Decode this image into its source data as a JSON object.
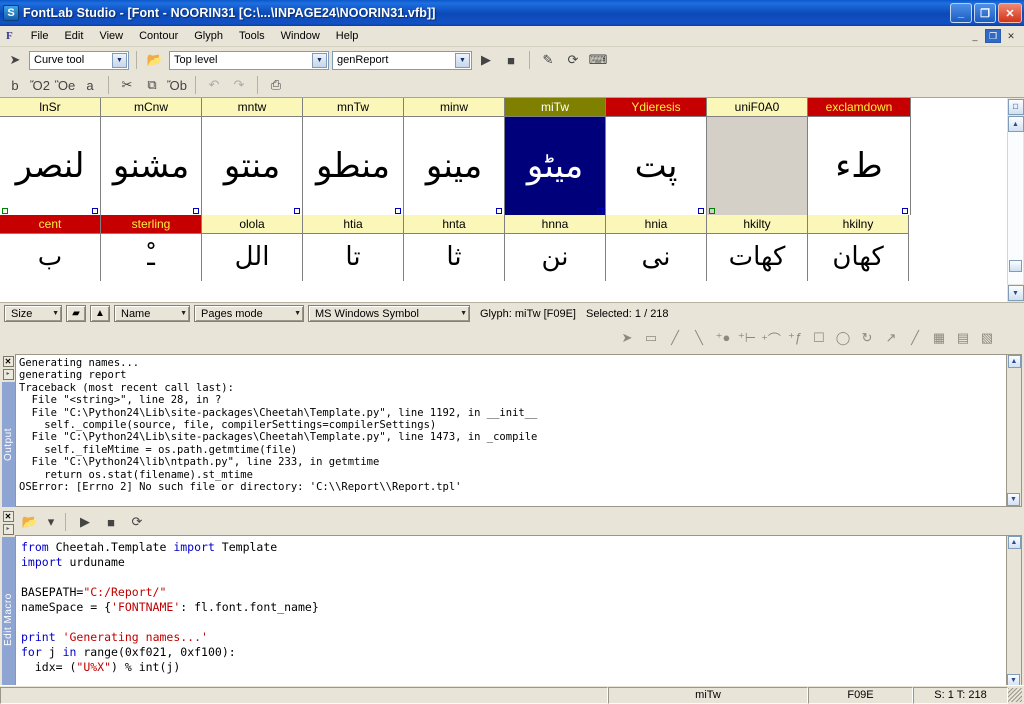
{
  "window": {
    "title": "FontLab Studio - [Font - NOORIN31 [C:\\...\\INPAGE24\\NOORIN31.vfb]]",
    "app_icon": "S",
    "buttons": {
      "minimize": "_",
      "restore": "❐",
      "close": "✕"
    }
  },
  "menu": {
    "logo": "F",
    "items": [
      "File",
      "Edit",
      "View",
      "Contour",
      "Glyph",
      "Tools",
      "Window",
      "Help"
    ],
    "mdi": {
      "minimize": "_",
      "restore": "❐",
      "close": "✕"
    }
  },
  "toolbar": {
    "pointer_icon": "➤",
    "tool_combo": "Curve tool",
    "open_macro_icon": "folder-macro-icon",
    "level_combo": "Top level",
    "macro_combo": "genReport",
    "run_icon": "▶",
    "stop_icon": "■",
    "edit_macro_icon": "✎",
    "reload_icon": "⟳",
    "console_icon": "⌨"
  },
  "filebar": {
    "new": "὜b",
    "open": "Ὄ2",
    "save": "Ὃe",
    "save_all": "὚a",
    "cut": "✂",
    "copy": "⧉",
    "paste": "Ὄb",
    "undo": "↶",
    "redo": "↷",
    "print": "⎙"
  },
  "glyph_grid": {
    "row1": [
      {
        "name": "lnSr",
        "style": "yellow",
        "glyph": "لنصر",
        "mark_left": "green",
        "mark_right": "blue"
      },
      {
        "name": "mCnw",
        "style": "yellow",
        "glyph": "مشنو",
        "mark_left": "",
        "mark_right": "blue"
      },
      {
        "name": "mntw",
        "style": "yellow",
        "glyph": "منتو",
        "mark_left": "",
        "mark_right": "blue"
      },
      {
        "name": "mnTw",
        "style": "yellow",
        "glyph": "منطو",
        "mark_left": "",
        "mark_right": "blue"
      },
      {
        "name": "minw",
        "style": "yellow",
        "glyph": "مینو",
        "mark_left": "",
        "mark_right": "blue"
      },
      {
        "name": "miTw",
        "style": "olive",
        "glyph": "میٹو",
        "mark_left": "",
        "mark_right": "blue",
        "selected": true
      },
      {
        "name": "Ydieresis",
        "style": "red",
        "glyph": "پت",
        "mark_left": "",
        "mark_right": "blue"
      },
      {
        "name": "uniF0A0",
        "style": "yellow",
        "glyph": "",
        "mark_left": "green",
        "mark_right": "",
        "grayed": true
      },
      {
        "name": "exclamdown",
        "style": "red",
        "glyph": "طء",
        "mark_left": "",
        "mark_right": "blue"
      }
    ],
    "row2": [
      {
        "name": "cent",
        "style": "red",
        "glyph": "ب"
      },
      {
        "name": "sterling",
        "style": "red",
        "glyph": "ـْ"
      },
      {
        "name": "olola",
        "style": "yellow",
        "glyph": "الل"
      },
      {
        "name": "htia",
        "style": "yellow",
        "glyph": "تا"
      },
      {
        "name": "hnta",
        "style": "yellow",
        "glyph": "ثا"
      },
      {
        "name": "hnna",
        "style": "yellow",
        "glyph": "نن"
      },
      {
        "name": "hnia",
        "style": "yellow",
        "glyph": "نی"
      },
      {
        "name": "hkilty",
        "style": "yellow",
        "glyph": "کھات"
      },
      {
        "name": "hkilny",
        "style": "yellow",
        "glyph": "کھان"
      }
    ]
  },
  "glyph_status": {
    "size_combo": "Size",
    "zoom_out_icon": "▰",
    "zoom_in_icon": "▲",
    "name_combo": "Name",
    "mode_combo": "Pages mode",
    "encoding_combo": "MS Windows Symbol",
    "glyph_info": "Glyph: miTw [F09E]",
    "selected_info": "Selected: 1 / 218"
  },
  "draw_toolbar": {
    "icons": [
      "arrow-icon",
      "eraser-icon",
      "knife-icon",
      "ruler-icon",
      "add-node-icon",
      "add-tangent-icon",
      "add-curve-icon",
      "add-corner-icon",
      "rectangle-icon",
      "ellipse-icon",
      "rotate-icon",
      "scale-icon",
      "slant-icon",
      "transform-icon",
      "metrics-icon",
      "kerning-icon"
    ]
  },
  "output_panel": {
    "label": "Output",
    "close_icon": "✕",
    "expand_icon": "▸",
    "text": "Generating names...\ngenerating report\nTraceback (most recent call last):\n  File \"<string>\", line 28, in ?\n  File \"C:\\Python24\\Lib\\site-packages\\Cheetah\\Template.py\", line 1192, in __init__\n    self._compile(source, file, compilerSettings=compilerSettings)\n  File \"C:\\Python24\\Lib\\site-packages\\Cheetah\\Template.py\", line 1473, in _compile\n    self._fileMtime = os.path.getmtime(file)\n  File \"C:\\Python24\\lib\\ntpath.py\", line 233, in getmtime\n    return os.stat(filename).st_mtime\nOSError: [Errno 2] No such file or directory: 'C:\\\\Report\\\\Report.tpl'"
  },
  "macro_panel": {
    "label": "Edit Macro",
    "close_icon": "✕",
    "expand_icon": "▸",
    "toolbar": {
      "open_icon": "folder-save-icon",
      "dropdown_icon": "▾",
      "run_icon": "▶",
      "stop_icon": "■",
      "reload_icon": "⟳"
    },
    "code_lines": [
      [
        [
          "kw",
          "from"
        ],
        [
          "txt",
          " Cheetah.Template "
        ],
        [
          "kw",
          "import"
        ],
        [
          "txt",
          " Template"
        ]
      ],
      [
        [
          "kw",
          "import"
        ],
        [
          "txt",
          " urduname"
        ]
      ],
      [
        [
          "txt",
          ""
        ]
      ],
      [
        [
          "txt",
          "BASEPATH="
        ],
        [
          "str",
          "\"C:/Report/\""
        ]
      ],
      [
        [
          "txt",
          "nameSpace = {"
        ],
        [
          "str",
          "'FONTNAME'"
        ],
        [
          "txt",
          ": fl.font.font_name}"
        ]
      ],
      [
        [
          "txt",
          ""
        ]
      ],
      [
        [
          "kw",
          "print"
        ],
        [
          "txt",
          " "
        ],
        [
          "str",
          "'Generating names...'"
        ]
      ],
      [
        [
          "kw",
          "for"
        ],
        [
          "txt",
          " j "
        ],
        [
          "kw",
          "in"
        ],
        [
          "txt",
          " range(0xf021, 0xf100):"
        ]
      ],
      [
        [
          "txt",
          "  idx= ("
        ],
        [
          "str",
          "\"U%X\""
        ],
        [
          "txt",
          ") % int(j)"
        ]
      ]
    ]
  },
  "statusbar": {
    "message": "",
    "glyph_name": "miTw",
    "glyph_code": "F09E",
    "counts": "S: 1  T: 218"
  }
}
